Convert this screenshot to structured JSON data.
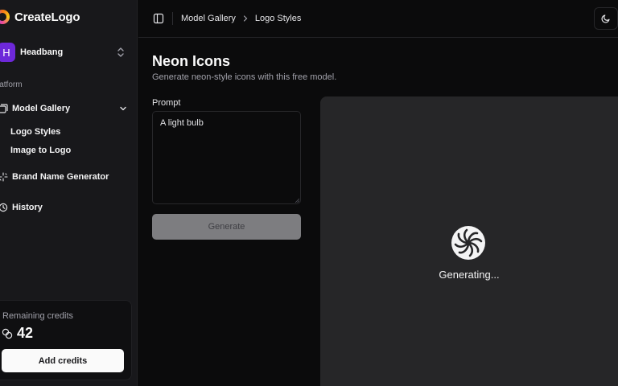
{
  "app": {
    "name": "CreateLogo"
  },
  "workspace": {
    "initial": "H",
    "name": "Headbang"
  },
  "sidebar": {
    "section_label": "Platform",
    "section_label_visible": "latform",
    "items": [
      {
        "label": "Model Gallery",
        "icon": "gallery-icon",
        "expanded": true,
        "children": [
          {
            "label": "Logo Styles"
          },
          {
            "label": "Image to Logo"
          }
        ]
      },
      {
        "label": "Brand Name Generator",
        "icon": "sparkles-icon"
      },
      {
        "label": "History",
        "icon": "clock-icon"
      }
    ],
    "credits": {
      "label": "Remaining credits",
      "value": "42",
      "button_label": "Add credits"
    }
  },
  "header": {
    "breadcrumb": [
      "Model Gallery",
      "Logo Styles"
    ]
  },
  "main": {
    "title": "Neon Icons",
    "subtitle": "Generate neon-style icons with this free model.",
    "prompt": {
      "label": "Prompt",
      "value": "A light bulb"
    },
    "generate_label": "Generate",
    "preview": {
      "status": "Generating..."
    }
  },
  "colors": {
    "sidebar_bg": "#18181b",
    "main_bg": "#0b0b0c",
    "preview_bg": "#262628",
    "avatar": "#6d28d9",
    "button_disabled": "#7d7d80"
  }
}
